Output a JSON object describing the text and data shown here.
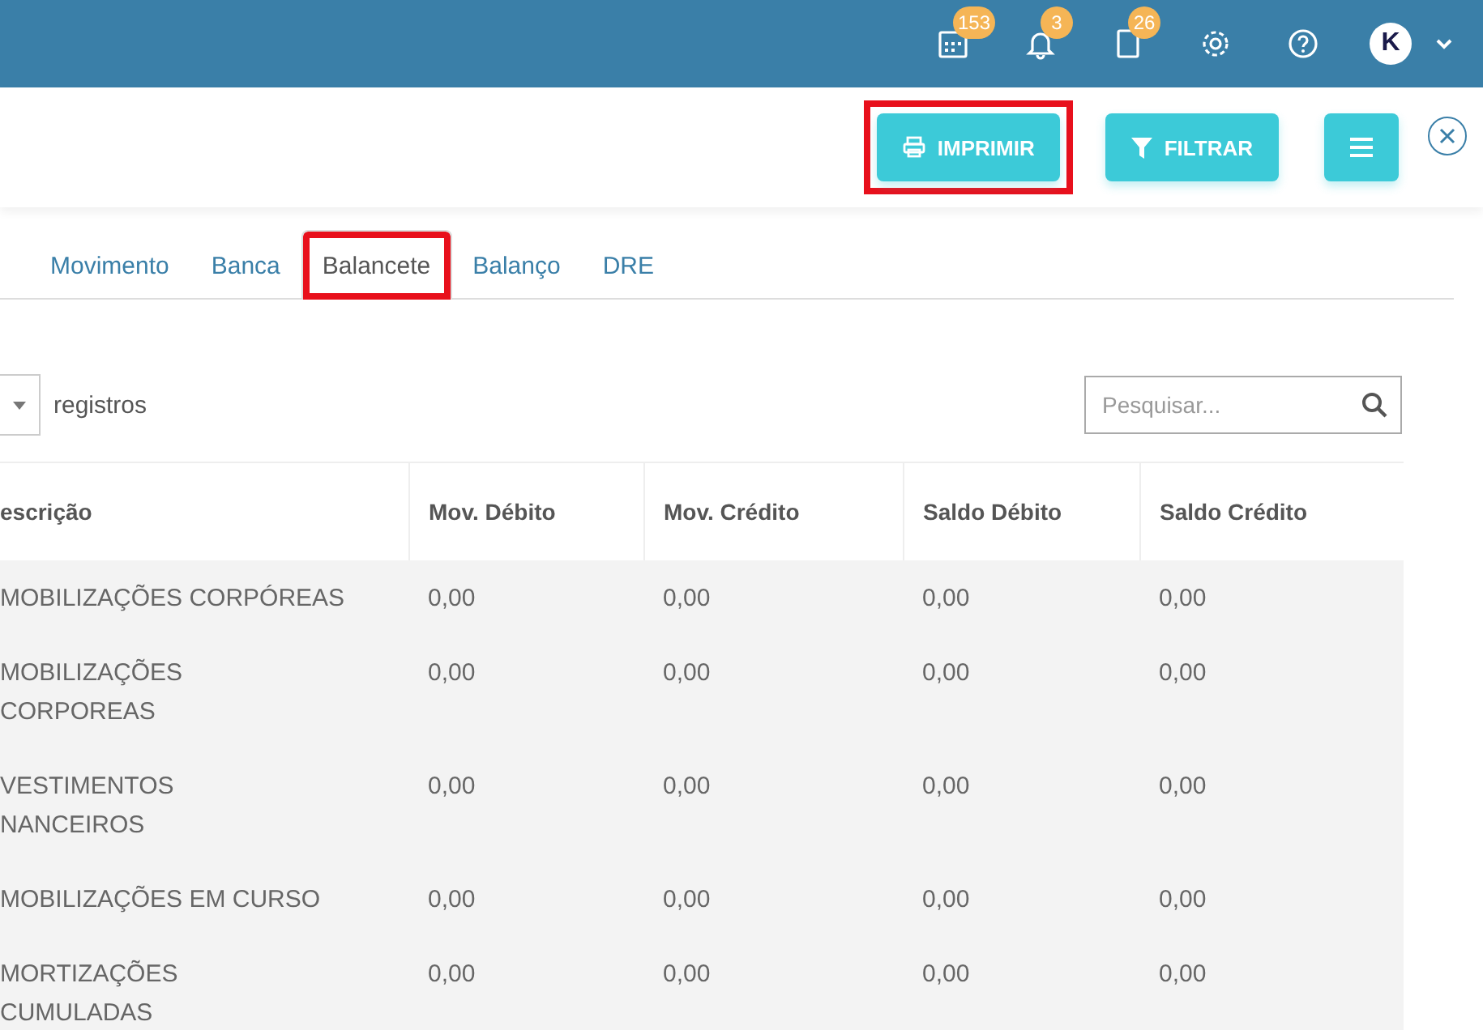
{
  "topbar": {
    "badges": [
      {
        "kind": "calendar",
        "count": "153"
      },
      {
        "kind": "bell",
        "count": "3"
      },
      {
        "kind": "document",
        "count": "26"
      }
    ],
    "avatar_letter": "K"
  },
  "actions": [
    {
      "kind": "print",
      "label": "IMPRIMIR",
      "highlighted": true
    },
    {
      "kind": "filter",
      "label": "FILTRAR",
      "highlighted": false
    },
    {
      "kind": "menu",
      "highlighted": false
    }
  ],
  "tabs": [
    {
      "label": "Movimento",
      "selected": false,
      "highlighted": false
    },
    {
      "label": "Banca",
      "selected": false,
      "highlighted": false
    },
    {
      "label": "Balancete",
      "selected": true,
      "highlighted": true
    },
    {
      "label": "Balanço",
      "selected": false,
      "highlighted": false
    },
    {
      "label": "DRE",
      "selected": false,
      "highlighted": false
    }
  ],
  "length_label": "registros",
  "search": {
    "placeholder": "Pesquisar..."
  },
  "table": {
    "columns": [
      "escrição",
      "Mov. Débito",
      "Mov. Crédito",
      "Saldo Débito",
      "Saldo Crédito"
    ],
    "rows": [
      {
        "description": [
          "MOBILIZAÇÕES CORPÓREAS"
        ],
        "values": [
          "0,00",
          "0,00",
          "0,00",
          "0,00"
        ]
      },
      {
        "description": [
          "MOBILIZAÇÕES",
          "CORPOREAS"
        ],
        "values": [
          "0,00",
          "0,00",
          "0,00",
          "0,00"
        ]
      },
      {
        "description": [
          "VESTIMENTOS",
          "NANCEIROS"
        ],
        "values": [
          "0,00",
          "0,00",
          "0,00",
          "0,00"
        ]
      },
      {
        "description": [
          "MOBILIZAÇÕES EM CURSO"
        ],
        "values": [
          "0,00",
          "0,00",
          "0,00",
          "0,00"
        ]
      },
      {
        "description": [
          "MORTIZAÇÕES",
          "CUMULADAS"
        ],
        "values": [
          "0,00",
          "0,00",
          "0,00",
          "0,00"
        ]
      }
    ]
  }
}
